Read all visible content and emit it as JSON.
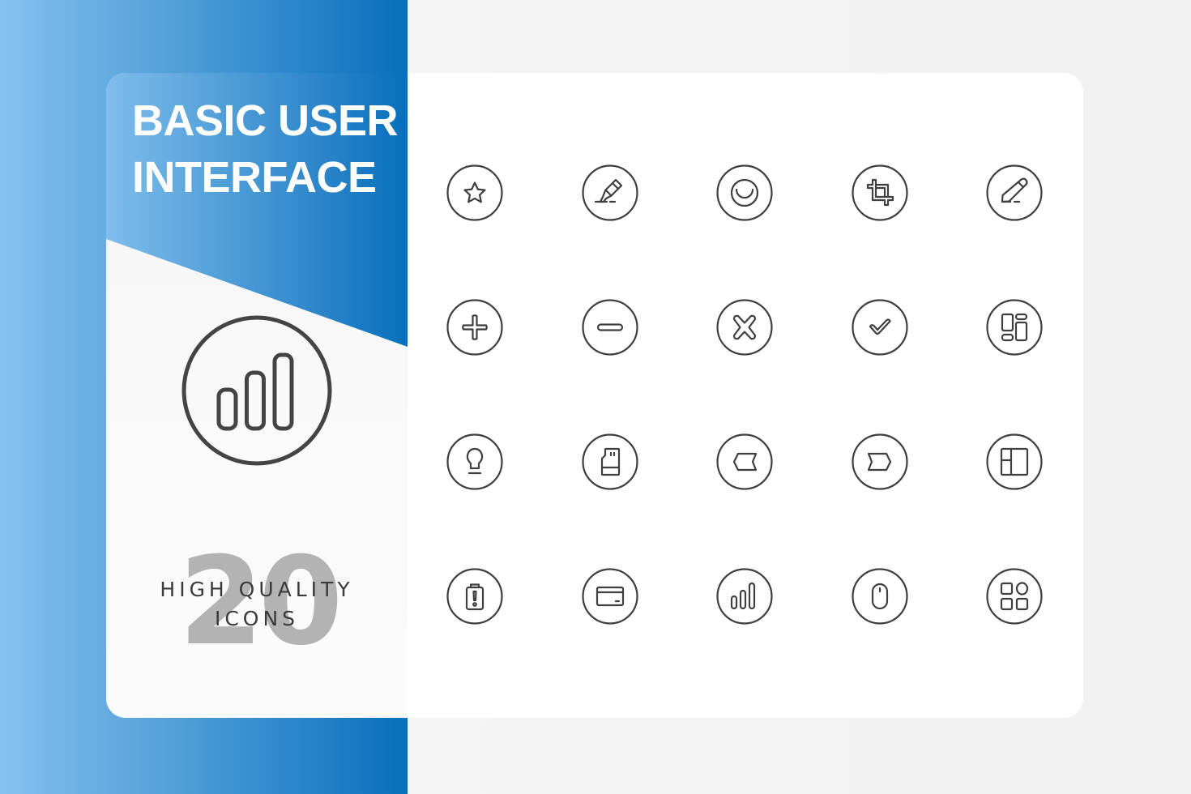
{
  "banner": {
    "title_line1": "BASIC USER",
    "title_line2": "INTERFACE",
    "hero_icon": "signal-bars-icon",
    "count": "20",
    "subtitle_line1": "HIGH QUALITY",
    "subtitle_line2": "ICONS"
  },
  "colors": {
    "blue_dark": "#0670bb",
    "blue_light": "#86c1ef",
    "icon_stroke": "#3f3f3f",
    "count_grey": "#b3b3b3",
    "background": "#f2f2f2",
    "card": "#ffffff"
  },
  "icons": [
    {
      "name": "star-icon"
    },
    {
      "name": "highlighter-icon"
    },
    {
      "name": "smile-circle-icon"
    },
    {
      "name": "crop-icon"
    },
    {
      "name": "pencil-icon"
    },
    {
      "name": "plus-icon"
    },
    {
      "name": "minus-icon"
    },
    {
      "name": "close-icon"
    },
    {
      "name": "check-icon"
    },
    {
      "name": "dashboard-layout-icon"
    },
    {
      "name": "lightbulb-icon"
    },
    {
      "name": "sd-card-icon"
    },
    {
      "name": "arrow-left-tag-icon"
    },
    {
      "name": "arrow-right-tag-icon"
    },
    {
      "name": "layout-panels-icon"
    },
    {
      "name": "battery-alert-icon"
    },
    {
      "name": "credit-card-icon"
    },
    {
      "name": "signal-bars-icon"
    },
    {
      "name": "mouse-icon"
    },
    {
      "name": "apps-grid-icon"
    }
  ]
}
